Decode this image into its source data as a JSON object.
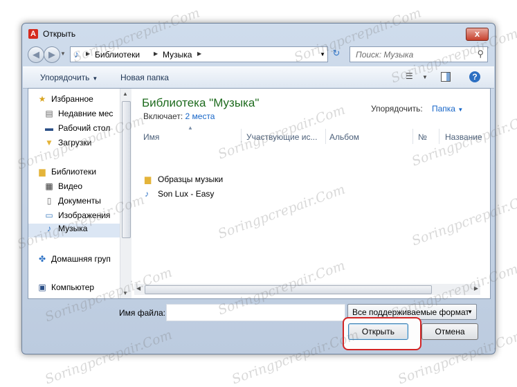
{
  "window": {
    "title": "Открыть",
    "close_label": "x"
  },
  "nav": {
    "breadcrumbs": [
      "Библиотеки",
      "Музыка"
    ],
    "search_placeholder": "Поиск: Музыка"
  },
  "toolbar": {
    "organize_label": "Упорядочить",
    "new_folder_label": "Новая папка"
  },
  "sidebar": {
    "items": [
      {
        "label": "Избранное",
        "icon": "star-icon"
      },
      {
        "label": "Недавние мес",
        "icon": "recent-places-icon"
      },
      {
        "label": "Рабочий стол",
        "icon": "desktop-icon"
      },
      {
        "label": "Загрузки",
        "icon": "downloads-icon"
      },
      {
        "label": "Библиотеки",
        "icon": "libraries-icon"
      },
      {
        "label": "Видео",
        "icon": "video-icon"
      },
      {
        "label": "Документы",
        "icon": "documents-icon"
      },
      {
        "label": "Изображения",
        "icon": "pictures-icon"
      },
      {
        "label": "Музыка",
        "icon": "music-icon",
        "selected": true
      },
      {
        "label": "Домашняя груп",
        "icon": "homegroup-icon"
      },
      {
        "label": "Компьютер",
        "icon": "computer-icon"
      }
    ]
  },
  "library": {
    "title": "Библиотека \"Музыка\"",
    "includes_label": "Включает:",
    "includes_value": "2 места",
    "arrange_label": "Упорядочить:",
    "arrange_value": "Папка"
  },
  "columns": [
    "Имя",
    "Участвующие ис...",
    "Альбом",
    "№",
    "Название"
  ],
  "files": [
    {
      "name": "Образцы музыки",
      "type": "folder"
    },
    {
      "name": "Son Lux - Easy",
      "type": "audio"
    }
  ],
  "footer": {
    "filename_label": "Имя файла:",
    "filename_value": "",
    "filetype_value": "Все поддерживаемые формат",
    "open_label": "Открыть",
    "cancel_label": "Отмена"
  },
  "watermark_text": "Soringpcrepair.Com",
  "colors": {
    "accent": "#1766c8",
    "library_title": "#1e6b1e",
    "highlight": "#d32424"
  }
}
